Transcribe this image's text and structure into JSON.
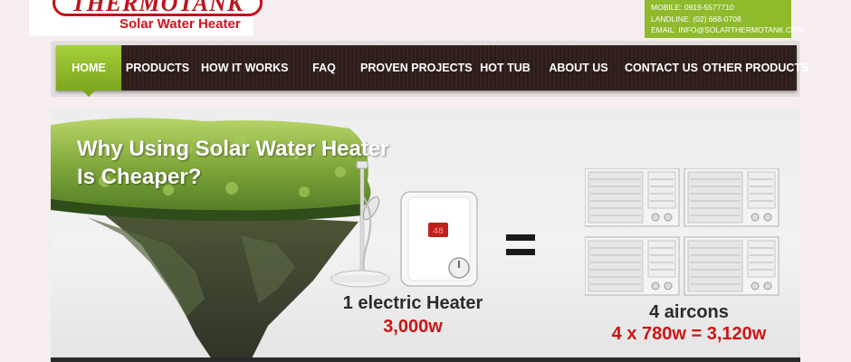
{
  "header": {
    "logo_text": "THERMOTANK",
    "logo_subtitle": "Solar Water Heater",
    "contact": {
      "mobile": "MOBILE: 0919-5577710",
      "landline": "LANDLINE: (02) 668-0708",
      "email": "EMAIL: INFO@SOLARTHERMOTANK.COM"
    }
  },
  "nav": {
    "items": [
      {
        "label": "HOME"
      },
      {
        "label": "PRODUCTS"
      },
      {
        "label": "HOW IT WORKS"
      },
      {
        "label": "FAQ"
      },
      {
        "label": "PROVEN PROJECTS"
      },
      {
        "label": "HOT TUB"
      },
      {
        "label": "ABOUT US"
      },
      {
        "label": "CONTACT US"
      },
      {
        "label": "OTHER PRODUCTS"
      }
    ],
    "active": "HOME"
  },
  "banner": {
    "title_line1": "Why Using Solar Water Heater",
    "title_line2": "Is Cheaper?",
    "heater_caption": "1 electric Heater",
    "heater_watt": "3,000w",
    "heater_display": "48",
    "aircon_caption": "4 aircons",
    "aircon_watt": "4 x 780w = 3,120w"
  },
  "colors": {
    "brand_red": "#c1121b",
    "accent_green": "#8fba2c",
    "nav_wood": "#2e1e1c",
    "highlight_red": "#cc1515"
  }
}
